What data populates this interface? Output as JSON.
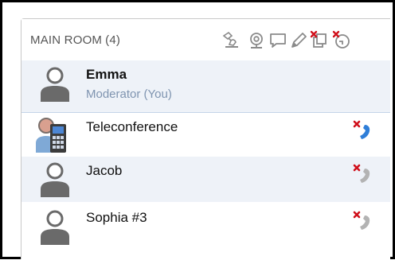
{
  "room": {
    "title": "MAIN ROOM",
    "count": "(4)"
  },
  "toolbar": {
    "icons": [
      "desktop-share-icon",
      "webcam-icon",
      "chat-icon",
      "pencil-icon",
      "blocked-copy-icon",
      "blocked-ticket-icon"
    ]
  },
  "participants": [
    {
      "name": "Emma",
      "role": "Moderator (You)",
      "avatar": "user-avatar-icon"
    },
    {
      "name": "Teleconference",
      "avatar": "teleconference-phone-icon",
      "call_state": "active"
    },
    {
      "name": "Jacob",
      "avatar": "user-avatar-icon",
      "call_state": "inactive"
    },
    {
      "name": "Sophia #3",
      "avatar": "user-avatar-icon",
      "call_state": "inactive"
    }
  ],
  "colors": {
    "highlight_row": "#eef2f8",
    "role_text": "#7f94b0",
    "phone_active": "#2f7ed8",
    "phone_inactive": "#b3b3b3",
    "blocked_red": "#d0101b"
  }
}
